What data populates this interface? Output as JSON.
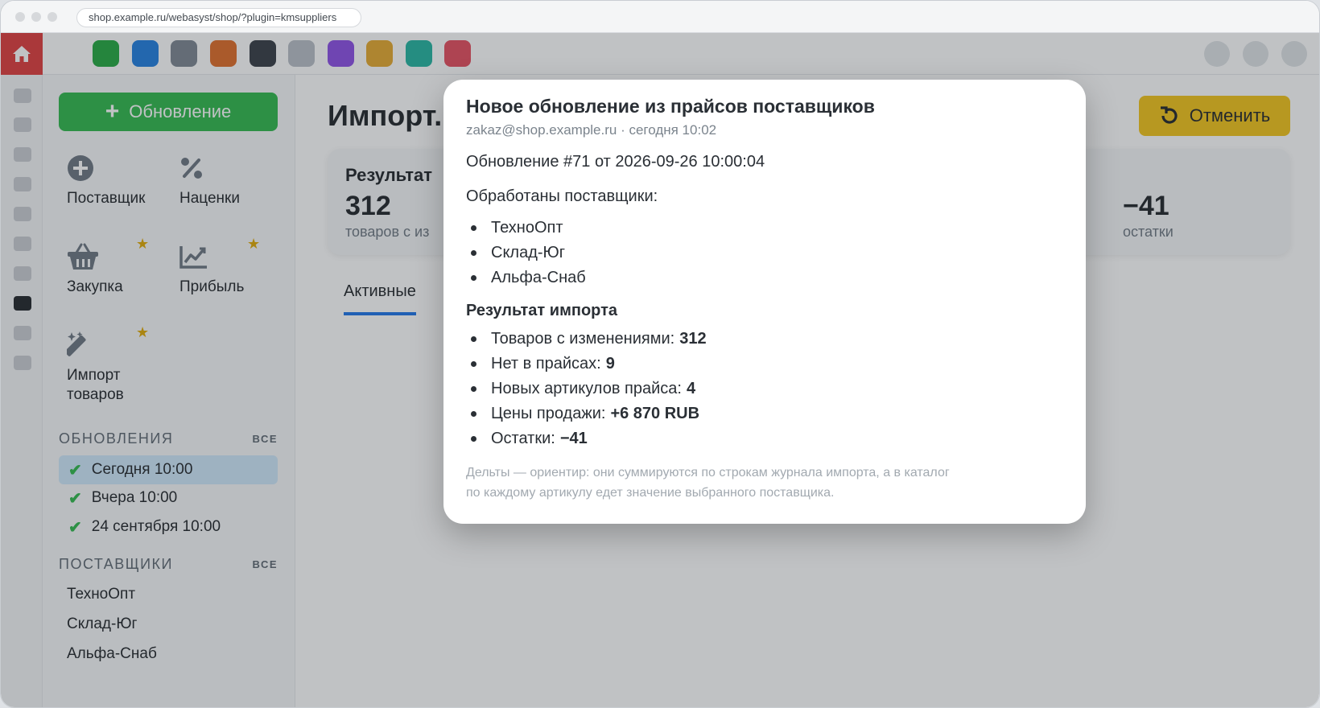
{
  "browser": {
    "url": "shop.example.ru/webasyst/shop/?plugin=kmsuppliers"
  },
  "colors": {
    "brand_red": "#e03a3a",
    "accent_green": "#2db84a",
    "accent_yellow": "#f3c316",
    "tab_blue": "#1a73e8"
  },
  "topbar": {
    "app_icons": [
      {
        "color": "#22a83e"
      },
      {
        "color": "#1f7de0"
      },
      {
        "color": "#7b8590"
      },
      {
        "color": "#e06a24"
      },
      {
        "color": "#343a42"
      },
      {
        "color": "#b8bec6"
      },
      {
        "color": "#8b4de6"
      },
      {
        "color": "#e6a82c"
      },
      {
        "color": "#21b3a0"
      },
      {
        "color": "#e64b5c"
      }
    ]
  },
  "sidebar": {
    "new_button": "Обновление",
    "tools": [
      {
        "label": "Поставщик",
        "icon": "plus-circle-icon"
      },
      {
        "label": "Наценки",
        "icon": "percent-icon"
      },
      {
        "label": "Закупка",
        "icon": "basket-icon"
      },
      {
        "label": "Прибыль",
        "icon": "chart-icon"
      },
      {
        "label": "Импорт товаров",
        "icon": "magic-wand-icon"
      }
    ],
    "updates_heading": "ОБНОВЛЕНИЯ",
    "updates_all": "ВСЕ",
    "updates": [
      "Сегодня 10:00",
      "Вчера 10:00",
      "24 сентября 10:00"
    ],
    "suppliers_heading": "ПОСТАВЩИКИ",
    "suppliers_all": "ВСЕ",
    "suppliers": [
      "ТехноОпт",
      "Склад-Юг",
      "Альфа-Снаб"
    ]
  },
  "main": {
    "title": "Импорт.",
    "cancel_button": "Отменить",
    "result_title": "Результат",
    "stat_left_value": "312",
    "stat_left_label": "товаров с из",
    "stat_right_value": "−41",
    "stat_right_label": "остатки",
    "tab_active": "Активные"
  },
  "modal": {
    "title": "Новое обновление из прайсов поставщиков",
    "meta": "zakaz@shop.example.ru · сегодня 10:02",
    "update_line": "Обновление #71 от 2026-09-26 10:00:04",
    "processed_heading": "Обработаны поставщики:",
    "suppliers": [
      "ТехноОпт",
      "Склад-Юг",
      "Альфа-Снаб"
    ],
    "result_heading": "Результат импорта",
    "results": [
      {
        "label": "Товаров с изменениями:",
        "value": "312"
      },
      {
        "label": "Нет в прайсах:",
        "value": "9"
      },
      {
        "label": "Новых артикулов прайса:",
        "value": "4"
      },
      {
        "label": "Цены продажи:",
        "value": "+6 870 RUB"
      },
      {
        "label": "Остатки:",
        "value": "−41"
      }
    ],
    "note_line1": "Дельты — ориентир: они суммируются по строкам журнала импорта, а в каталог",
    "note_line2": "по каждому артикулу едет значение выбранного поставщика."
  }
}
